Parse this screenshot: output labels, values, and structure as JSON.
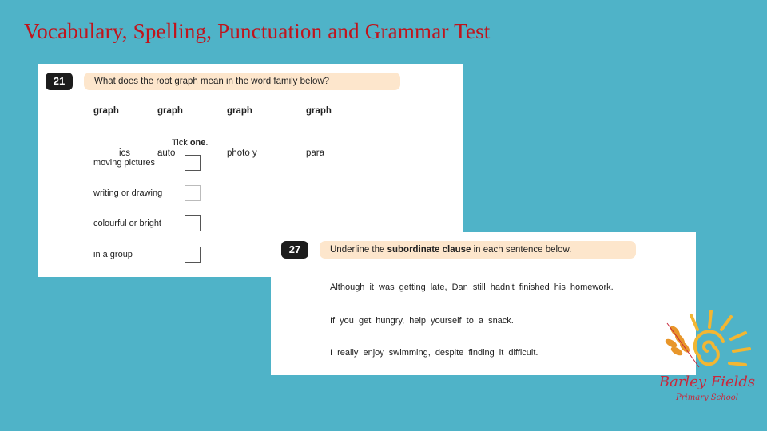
{
  "slide_title": "Vocabulary, Spelling, Punctuation and Grammar Test",
  "question21": {
    "number": "21",
    "prompt_before": "What does the root ",
    "prompt_root": "graph",
    "prompt_after": " mean in the word family below?",
    "words": [
      {
        "pre": "",
        "bold": "graph",
        "post": "ics"
      },
      {
        "pre": "auto",
        "bold": "graph",
        "post": ""
      },
      {
        "pre": "photo",
        "bold": "graph",
        "post": "y"
      },
      {
        "pre": "para",
        "bold": "graph",
        "post": ""
      }
    ],
    "instruction_pre": "Tick ",
    "instruction_bold": "one",
    "instruction_post": ".",
    "options": [
      "moving pictures",
      "writing or drawing",
      "colourful or bright",
      "in a group"
    ]
  },
  "question27": {
    "number": "27",
    "prompt_before": "Underline the ",
    "prompt_bold": "subordinate clause",
    "prompt_after": " in each sentence below.",
    "sentences": [
      "Although it was getting late, Dan still hadn’t finished his homework.",
      "If you get hungry, help yourself to a snack.",
      "I really enjoy swimming, despite finding it difficult."
    ]
  },
  "logo": {
    "name": "Barley Fields",
    "subtitle": "Primary School",
    "colors": {
      "text": "#c8283c",
      "sun": "#f2b632",
      "wheat": "#e8962a"
    }
  },
  "colors": {
    "background": "#4fb3c8",
    "title": "#c0141c",
    "question_bar": "#fde6cc",
    "number_badge": "#1c1c1c"
  }
}
